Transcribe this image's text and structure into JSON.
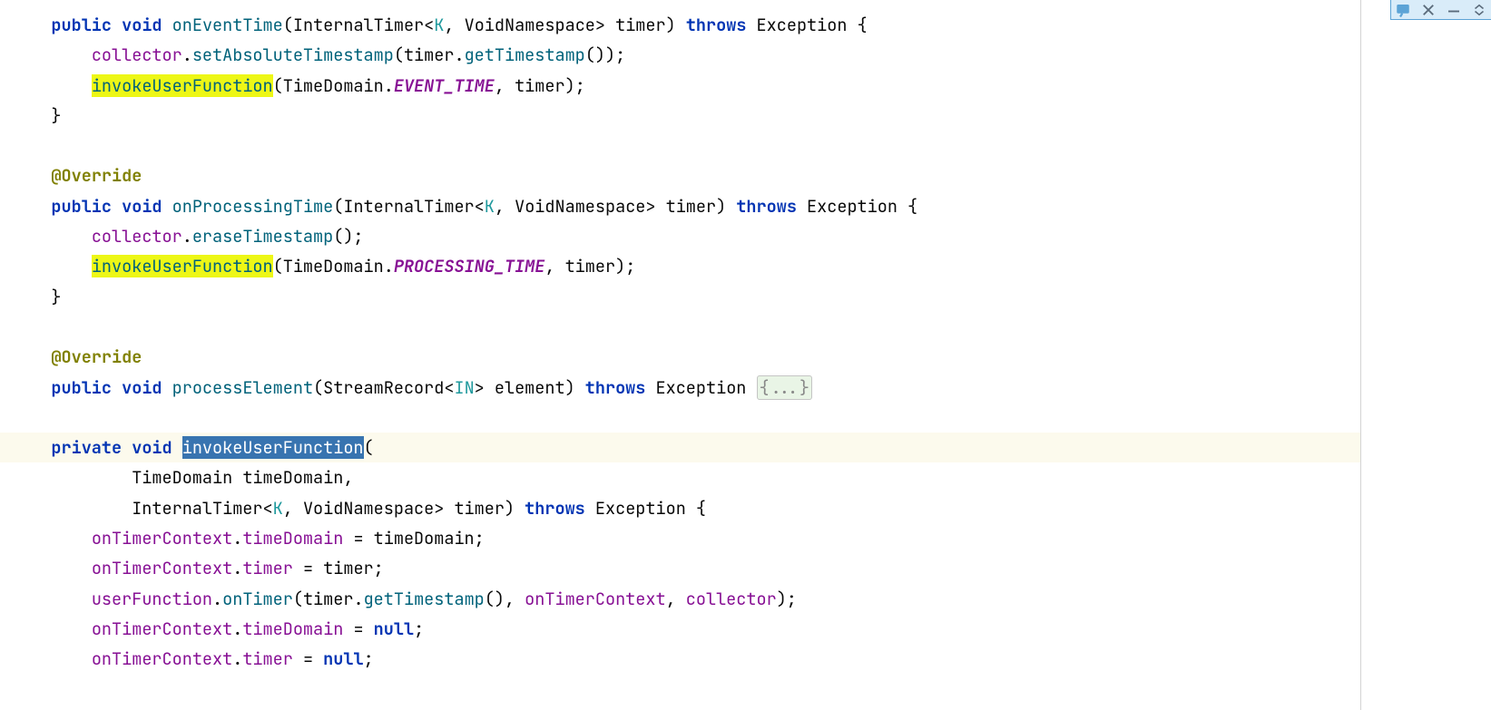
{
  "colors": {
    "keyword": "#0033b3",
    "annotation": "#808000",
    "method": "#00627a",
    "generic": "#20999d",
    "field": "#871094",
    "highlight": "#edf716",
    "selection": "#3874b0",
    "lineHighlight": "#fcfaed"
  },
  "code": {
    "m1": {
      "sig_public": "public",
      "sig_void": "void",
      "sig_name": "onEventTime",
      "sig_param_type": "InternalTimer",
      "sig_gen_k": "K",
      "sig_gen_ns": "VoidNamespace",
      "sig_param_name": "timer",
      "sig_throws": "throws",
      "sig_exc": "Exception",
      "l1_a": "collector",
      "l1_b": "setAbsoluteTimestamp",
      "l1_c": "timer",
      "l1_d": "getTimestamp",
      "l2_call": "invokeUserFunction",
      "l2_td": "TimeDomain",
      "l2_const": "EVENT_TIME",
      "l2_arg": "timer"
    },
    "ann": "@Override",
    "m2": {
      "sig_public": "public",
      "sig_void": "void",
      "sig_name": "onProcessingTime",
      "sig_param_type": "InternalTimer",
      "sig_gen_k": "K",
      "sig_gen_ns": "VoidNamespace",
      "sig_param_name": "timer",
      "sig_throws": "throws",
      "sig_exc": "Exception",
      "l1_a": "collector",
      "l1_b": "eraseTimestamp",
      "l2_call": "invokeUserFunction",
      "l2_td": "TimeDomain",
      "l2_const": "PROCESSING_TIME",
      "l2_arg": "timer"
    },
    "m3": {
      "sig_public": "public",
      "sig_void": "void",
      "sig_name": "processElement",
      "sig_param_type": "StreamRecord",
      "sig_gen": "IN",
      "sig_param_name": "element",
      "sig_throws": "throws",
      "sig_exc": "Exception",
      "fold": "{...}"
    },
    "m4": {
      "sig_private": "private",
      "sig_void": "void",
      "sig_name": "invokeUserFunction",
      "p1_type": "TimeDomain",
      "p1_name": "timeDomain",
      "p2_type": "InternalTimer",
      "p2_gen_k": "K",
      "p2_gen_ns": "VoidNamespace",
      "p2_name": "timer",
      "sig_throws": "throws",
      "sig_exc": "Exception",
      "b1_a": "onTimerContext",
      "b1_b": "timeDomain",
      "b1_c": "timeDomain",
      "b2_a": "onTimerContext",
      "b2_b": "timer",
      "b2_c": "timer",
      "b3_a": "userFunction",
      "b3_b": "onTimer",
      "b3_c": "timer",
      "b3_d": "getTimestamp",
      "b3_e": "onTimerContext",
      "b3_f": "collector",
      "b4_a": "onTimerContext",
      "b4_b": "timeDomain",
      "b4_null": "null",
      "b5_a": "onTimerContext",
      "b5_b": "timer",
      "b5_null": "null"
    }
  }
}
